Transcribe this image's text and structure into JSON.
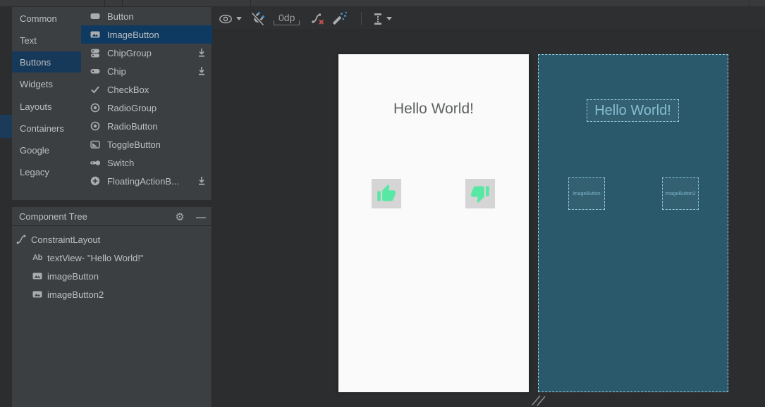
{
  "palette": {
    "categories": [
      {
        "label": "Common",
        "selected": false
      },
      {
        "label": "Text",
        "selected": false
      },
      {
        "label": "Buttons",
        "selected": true
      },
      {
        "label": "Widgets",
        "selected": false
      },
      {
        "label": "Layouts",
        "selected": false
      },
      {
        "label": "Containers",
        "selected": false
      },
      {
        "label": "Google",
        "selected": false
      },
      {
        "label": "Legacy",
        "selected": false
      }
    ],
    "components": [
      {
        "label": "Button",
        "icon": "button-icon",
        "downloadable": false,
        "selected": false
      },
      {
        "label": "ImageButton",
        "icon": "image-button-icon",
        "downloadable": false,
        "selected": true
      },
      {
        "label": "ChipGroup",
        "icon": "chip-group-icon",
        "downloadable": true,
        "selected": false
      },
      {
        "label": "Chip",
        "icon": "chip-icon",
        "downloadable": true,
        "selected": false
      },
      {
        "label": "CheckBox",
        "icon": "checkbox-icon",
        "downloadable": false,
        "selected": false
      },
      {
        "label": "RadioGroup",
        "icon": "radio-group-icon",
        "downloadable": false,
        "selected": false
      },
      {
        "label": "RadioButton",
        "icon": "radio-button-icon",
        "downloadable": false,
        "selected": false
      },
      {
        "label": "ToggleButton",
        "icon": "toggle-button-icon",
        "downloadable": false,
        "selected": false
      },
      {
        "label": "Switch",
        "icon": "switch-icon",
        "downloadable": false,
        "selected": false
      },
      {
        "label": "FloatingActionB...",
        "icon": "fab-icon",
        "downloadable": true,
        "selected": false
      }
    ]
  },
  "component_tree": {
    "title": "Component Tree",
    "items": [
      {
        "label": "ConstraintLayout",
        "icon": "constraint-layout-icon",
        "depth": 0
      },
      {
        "label": "textView- \"Hello World!\"",
        "icon": "text-view-icon",
        "depth": 1
      },
      {
        "label": "imageButton",
        "icon": "image-button-icon",
        "depth": 1
      },
      {
        "label": "imageButton2",
        "icon": "image-button-icon",
        "depth": 1
      }
    ]
  },
  "toolbar": {
    "margin_value": "0dp",
    "icons": [
      "view-options-icon",
      "autoconnect-off-icon",
      "default-margins",
      "clear-constraints-icon",
      "infer-constraints-icon",
      "pack-selection-icon"
    ]
  },
  "design_view": {
    "hello_text": "Hello World!"
  },
  "blueprint_view": {
    "hello_text": "Hello World!",
    "image_button1_label": "imageButton",
    "image_button2_label": "imageButton2"
  },
  "icons": {
    "gear": "⚙",
    "minimize": "—",
    "text_view": "Ab"
  },
  "colors": {
    "panel_bg": "#3c3f41",
    "canvas_bg": "#2b2d2f",
    "selection_blue": "#0e3a61",
    "category_selection": "#16395a",
    "stripe_indicator": "#1b3b58",
    "icon_gray": "#a9abad",
    "blueprint_bg": "#29596b",
    "blueprint_line": "#8fc7d9",
    "design_card_bg": "#fafafa",
    "thumb_green": "#57e8a4",
    "thumb_btn_bg": "#d5d5d5",
    "clear_x_red": "#c75450",
    "accent_blue": "#3e8fd0"
  }
}
